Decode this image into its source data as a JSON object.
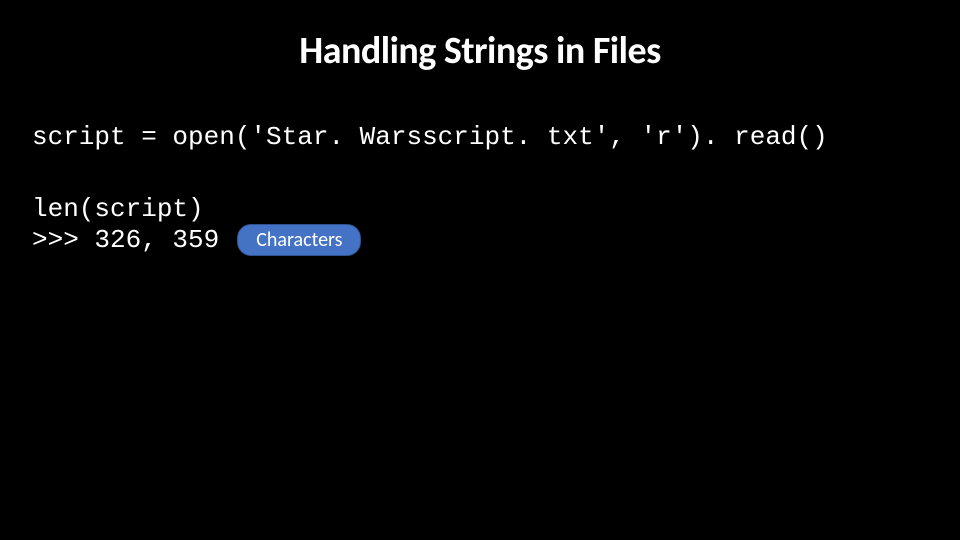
{
  "title": "Handling Strings in Files",
  "code": {
    "line1": "script = open('Star. Warsscript. txt', 'r'). read()",
    "line2": "len(script)",
    "line3": ">>> 326, 359"
  },
  "badge": {
    "label": "Characters"
  }
}
